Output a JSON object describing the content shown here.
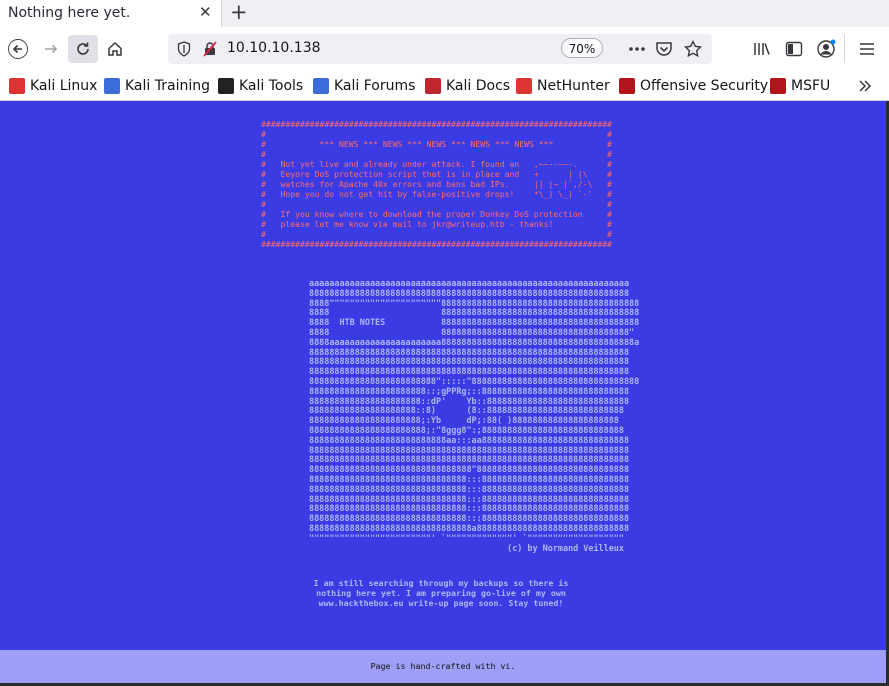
{
  "tab": {
    "title": "Nothing here yet.",
    "close": "✕",
    "new_tab": "+"
  },
  "address": {
    "url": "10.10.10.138",
    "zoom": "70%"
  },
  "bookmarks": [
    {
      "label": "Kali Linux",
      "icon": "kali-linux-icon",
      "color": "#d33"
    },
    {
      "label": "Kali Training",
      "icon": "kali-training-icon",
      "color": "#3b6cd8"
    },
    {
      "label": "Kali Tools",
      "icon": "kali-tools-icon",
      "color": "#222"
    },
    {
      "label": "Kali Forums",
      "icon": "kali-forums-icon",
      "color": "#3b6cd8"
    },
    {
      "label": "Kali Docs",
      "icon": "kali-docs-icon",
      "color": "#c0262d"
    },
    {
      "label": "NetHunter",
      "icon": "nethunter-icon",
      "color": "#d33"
    },
    {
      "label": "Offensive Security",
      "icon": "offensive-security-icon",
      "color": "#b3141c"
    },
    {
      "label": "MSFU",
      "icon": "msfu-icon",
      "color": "#b3141c"
    }
  ],
  "page": {
    "news_lines": [
      "########################################################################",
      "#                                                                      #",
      "#           *** NEWS *** NEWS *** NEWS *** NEWS *** NEWS ***           #",
      "#                                                                      #",
      "#   Not yet live and already under attack. I found an   ,~~--~~-.      #",
      "#   Eeyore DoS protection script that is in place and   +      | |\\    #",
      "#   watches for Apache 40x errors and bans bad IPs.     || |~ |`,/-\\   #",
      "#   Hope you do not get hit by false-positive drops!    *\\_) \\_) `-'   #",
      "#                                                                      #",
      "#   If you know where to download the proper Donkey DoS protection     #",
      "#   please let me know via mail to jkr@writeup.htb - thanks!           #",
      "#                                                                      #",
      "########################################################################"
    ],
    "art_lines": [
      "aaaaaaaaaaaaaaaaaaaaaaaaaaaaaaaaaaaaaaaaaaaaaaaaaaaaaaaaaaaaaaa",
      "888888888888888888888888888888888888888888888888888888888888888",
      "8888\"\"\"\"\"\"\"\"\"\"\"\"\"\"\"\"\"\"\"\"\"\"888888888888888888888888888888888888888",
      "8888                      888888888888888888888888888888888888888",
      "8888  HTB NOTES           888888888888888888888888888888888888888",
      "8888                      8888888888888888888888888888888888888\"",
      "8888aaaaaaaaaaaaaaaaaaaaaa88888888888888888888888888888888888888a",
      "888888888888888888888888888888888888888888888888888888888888888",
      "888888888888888888888888888888888888888888888888888888888888888",
      "888888888888888888888888888888888888888888888888888888888888888",
      "8888888888888888888888888\":::::\"888888888888888888888888888888888",
      "88888888888888888888888::;gPPRg;::88888888888888888888888888888",
      "8888888888888888888888::dP'    Yb::8888888888888888888888888888",
      "888888888888888888888::8)      (8::888888888888888888888888888",
      "8888888888888888888888;:Yb     dP;:88( )888888888888888888888",
      "88888888888888888888888;:\"8ggg8\":;8888888888888888888888888888",
      "888888888888888888888888888aa:::aa88888888888888888888888888888",
      "888888888888888888888888888888888888888888888888888888888888888",
      "888888888888888888888888888888888888888888888888888888888888888",
      "88888888888888888888888888888888\"888888888888888888888888888888",
      "8888888888888888888888888888888:::88888888888888888888888888888",
      "8888888888888888888888888888888:::88888888888888888888888888888",
      "8888888888888888888888888888888:::88888888888888888888888888888",
      "8888888888888888888888888888888:::88888888888888888888888888888",
      "8888888888888888888888888888888:::88888888888888888888888888888",
      "88888888888888888888888888888888a888888888888888888888888888888",
      "\"\"\"\"\"\"\"\"\"\"\"\"\"\"\"\"\"\"\"\"\"\"\"\"' `\"\"\"\"\"\"\"\"\"\"\"\"\"' `\"\"\"\"\"\"\"\"\"\"\"\"\"\"\"\"\"\"\"",
      "                                       (c) by Normand Veilleux"
    ],
    "message_lines": [
      "I am still searching through my backups so there is",
      "nothing here yet. I am preparing go-live of my own",
      "www.hackthebox.eu write-up page soon. Stay tuned!"
    ],
    "footer": "Page is hand-crafted with vi."
  },
  "colors": {
    "page_bg": "#3b3be3",
    "news": "#ff6b6b",
    "art": "#aeb6f7",
    "footer_bg": "#9f9ff7"
  }
}
